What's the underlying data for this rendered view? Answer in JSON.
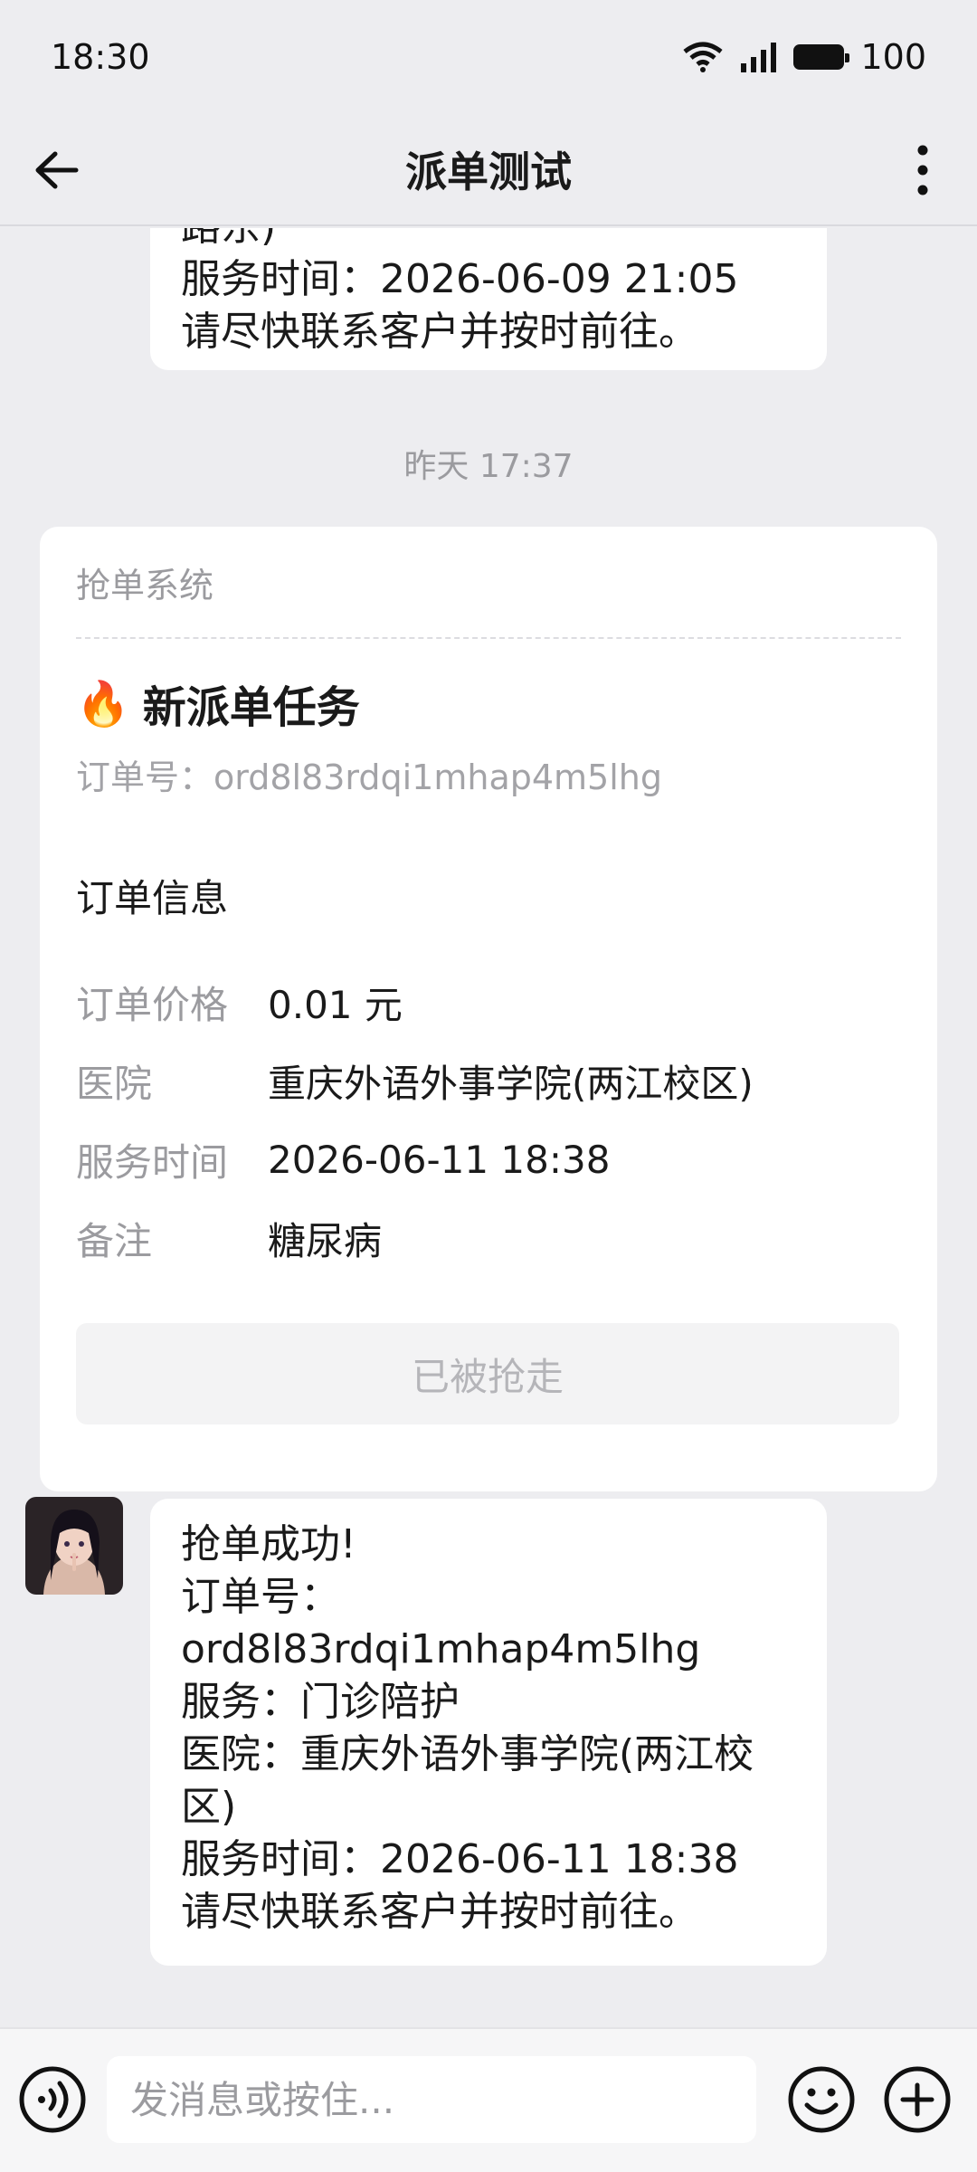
{
  "status_bar": {
    "time": "18:30",
    "battery": "100"
  },
  "header": {
    "title": "派单测试"
  },
  "messages": {
    "top_bubble": {
      "lines": [
        "路东)",
        "服务时间：2026-06-09 21:05",
        "请尽快联系客户并按时前往。"
      ]
    },
    "timestamp": "昨天 17:37",
    "order_card": {
      "source": "抢单系统",
      "emoji": "🔥",
      "title": "新派单任务",
      "order_no": "订单号：ord8l83rdqi1mhap4m5lhg",
      "section_title": "订单信息",
      "rows": [
        {
          "key": "订单价格",
          "value": "0.01 元"
        },
        {
          "key": "医院",
          "value": "重庆外语外事学院(两江校区)"
        },
        {
          "key": "服务时间",
          "value": "2026-06-11 18:38"
        },
        {
          "key": "备注",
          "value": "糖尿病"
        }
      ],
      "button_label": "已被抢走"
    },
    "bottom_bubble": {
      "lines": [
        "抢单成功!",
        "订单号：",
        "ord8l83rdqi1mhap4m5lhg",
        "服务：门诊陪护",
        "医院：重庆外语外事学院(两江校",
        "区)",
        "服务时间：2026-06-11 18:38",
        "请尽快联系客户并按时前往。"
      ]
    }
  },
  "input_bar": {
    "placeholder": "发消息或按住..."
  }
}
